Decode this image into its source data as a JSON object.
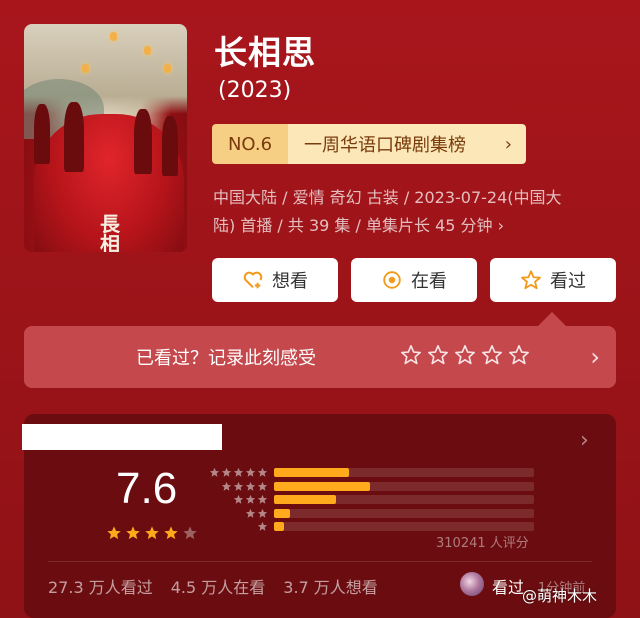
{
  "show": {
    "title": "长相思",
    "year": "(2023)",
    "poster_calligraphy": "長相思"
  },
  "rank": {
    "number": "NO.6",
    "list_name": "一周华语口碑剧集榜",
    "chevron": "›"
  },
  "meta": {
    "line1": "中国大陆 / 爱情 奇幻 古装 / 2023-07-24(中国大",
    "line2": "陆) 首播 / 共 39 集 / 单集片长 45 分钟 ›"
  },
  "actions": [
    {
      "label": "想看",
      "icon": "heart-plus-icon"
    },
    {
      "label": "在看",
      "icon": "target-dot-icon"
    },
    {
      "label": "看过",
      "icon": "star-outline-icon"
    }
  ],
  "record": {
    "prompt": "已看过？记录此刻感受",
    "star_count": 5,
    "chevron": "›"
  },
  "rating": {
    "score": "7.6",
    "stars_filled": 4,
    "stars_total": 5,
    "distribution": [
      {
        "stars": 5,
        "fraction": 0.29
      },
      {
        "stars": 4,
        "fraction": 0.37
      },
      {
        "stars": 3,
        "fraction": 0.24
      },
      {
        "stars": 2,
        "fraction": 0.06
      },
      {
        "stars": 1,
        "fraction": 0.04
      }
    ],
    "count_text": "310241 人评分",
    "top_chevron": "›"
  },
  "stats": {
    "watched": "27.3 万人看过",
    "watching": "4.5 万人在看",
    "want": "3.7 万人想看"
  },
  "friend_activity": {
    "action": "看过",
    "time": "1分钟前"
  },
  "watermark": "@萌神木木",
  "colors": {
    "background": "#a8161c",
    "rank_badge": "#f6cf85",
    "rank_bar": "#fbe7b7",
    "star_orange": "#ffaa1c",
    "rating_card": "#6b0d10"
  }
}
